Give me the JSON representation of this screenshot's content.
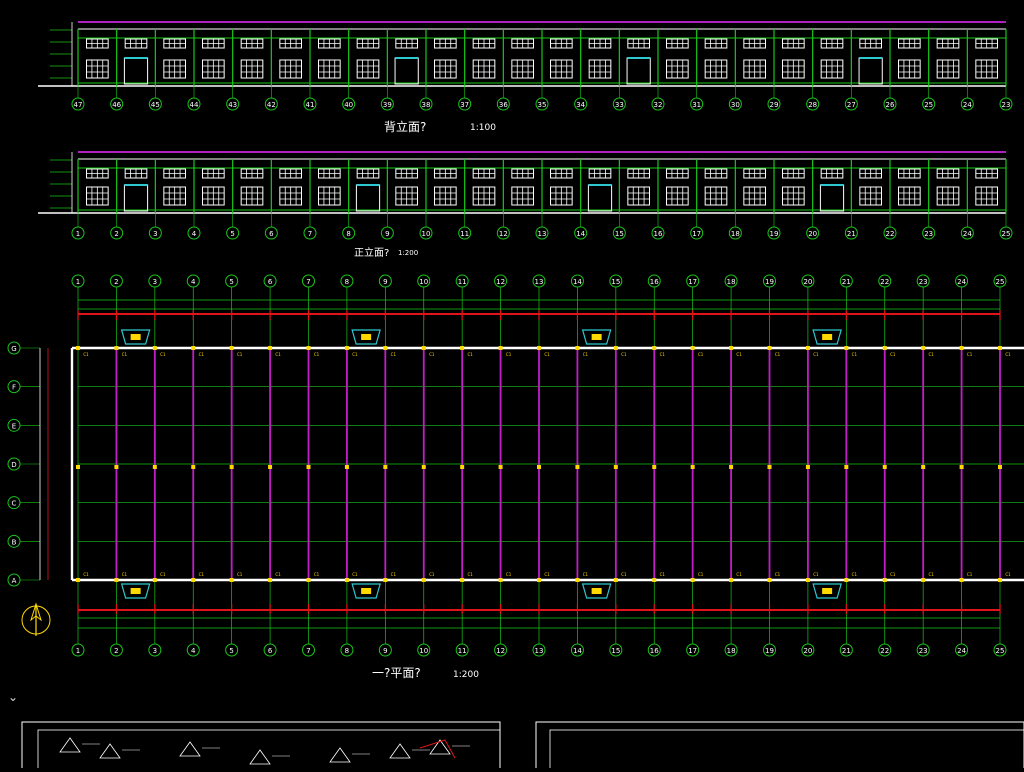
{
  "drawing": {
    "rear_elevation": {
      "title": "背立面?",
      "scale": "1:100",
      "axis_numbers": [
        "47",
        "46",
        "45",
        "44",
        "43",
        "42",
        "41",
        "40",
        "39",
        "38",
        "37",
        "36",
        "35",
        "34",
        "33",
        "32",
        "31",
        "30",
        "29",
        "28",
        "27",
        "26",
        "25",
        "24",
        "23"
      ]
    },
    "front_elevation": {
      "title": "正立面?",
      "scale": "1:200",
      "axis_numbers": [
        "1",
        "2",
        "3",
        "4",
        "5",
        "6",
        "7",
        "8",
        "9",
        "10",
        "11",
        "12",
        "13",
        "14",
        "15",
        "16",
        "17",
        "18",
        "19",
        "20",
        "21",
        "22",
        "23",
        "24",
        "25"
      ]
    },
    "plan": {
      "title": "一?平面?",
      "scale": "1:200",
      "axis_numbers": [
        "1",
        "2",
        "3",
        "4",
        "5",
        "6",
        "7",
        "8",
        "9",
        "10",
        "11",
        "12",
        "13",
        "14",
        "15",
        "16",
        "17",
        "18",
        "19",
        "20",
        "21",
        "22",
        "23",
        "24",
        "25"
      ],
      "row_axes": [
        "G",
        "F",
        "E",
        "D",
        "C",
        "B",
        "A"
      ]
    },
    "colors": {
      "grid": "#19c619",
      "wall": "#ffffff",
      "column": "#c21ec8",
      "dimension": "#e0141a",
      "window": "#ffffff",
      "parapet": "#b020c0",
      "door": "#2ec8d0",
      "marker": "#ffd800"
    }
  },
  "ui": {
    "collapse_icon": "chevron-down-icon"
  }
}
